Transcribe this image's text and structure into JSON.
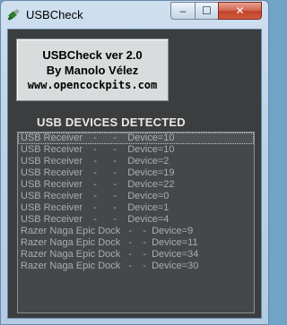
{
  "window": {
    "title": "USBCheck",
    "controls": {
      "minimize": "–",
      "maximize": "☐",
      "close": "✕"
    }
  },
  "info": {
    "line1": "USBCheck ver 2.0",
    "line2": "By Manolo Vélez",
    "line3": "www.opencockpits.com"
  },
  "heading": "USB DEVICES DETECTED",
  "devices": [
    "USB Receiver    -      -    Device=10",
    "USB Receiver    -      -    Device=10",
    "USB Receiver    -      -    Device=2",
    "USB Receiver    -      -    Device=19",
    "USB Receiver    -      -    Device=22",
    "USB Receiver    -      -    Device=0",
    "USB Receiver    -      -    Device=1",
    "USB Receiver    -      -    Device=4",
    "Razer Naga Epic Dock   -    -  Device=9",
    "Razer Naga Epic Dock   -    -  Device=11",
    "Razer Naga Epic Dock   -    -  Device=34",
    "Razer Naga Epic Dock   -    -  Device=30"
  ],
  "selected_index": 0,
  "icon": "usb-plug-icon"
}
